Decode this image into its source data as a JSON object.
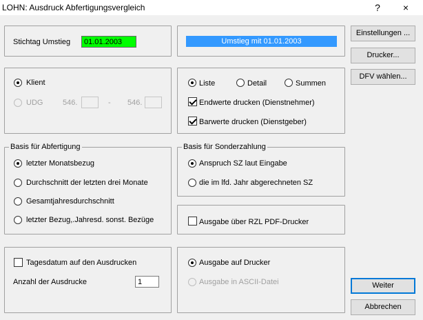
{
  "window": {
    "title": "LOHN: Ausdruck Abfertigungsvergleich",
    "help_glyph": "?",
    "close_glyph": "×"
  },
  "stichtag": {
    "label": "Stichtag Umstieg",
    "value": "01.01.2003",
    "value_bg": "#00ff00"
  },
  "umstieg_banner": {
    "text": "Umstieg mit 01.01.2003",
    "bg": "#3399ff"
  },
  "scope": {
    "klient_label": "Klient",
    "udg_label": "UDG",
    "range_prefix_1": "546.",
    "range_sep": "-",
    "range_prefix_2": "546.",
    "range_from": "",
    "range_to": ""
  },
  "mode": {
    "liste": "Liste",
    "detail": "Detail",
    "summen": "Summen",
    "endwerte": "Endwerte drucken (Dienstnehmer)",
    "barwerte": "Barwerte drucken (Dienstgeber)"
  },
  "basis_abfertigung": {
    "legend": "Basis für Abfertigung",
    "options": [
      "letzter Monatsbezug",
      "Durchschnitt der letzten drei Monate",
      "Gesamtjahresdurchschnitt",
      "letzter Bezug,.Jahresd. sonst. Bezüge"
    ]
  },
  "basis_sonderzahlung": {
    "legend": "Basis für Sonderzahlung",
    "options": [
      "Anspruch SZ laut Eingabe",
      "die im lfd. Jahr abgerechneten SZ"
    ]
  },
  "rzl": {
    "label": "Ausgabe über RZL PDF-Drucker"
  },
  "tagesdatum": {
    "label": "Tagesdatum auf den Ausdrucken"
  },
  "anzahl": {
    "label": "Anzahl der Ausdrucke",
    "value": "1"
  },
  "ausgabe": {
    "drucker": "Ausgabe auf Drucker",
    "ascii": "Ausgabe in ASCII-Datei"
  },
  "buttons": {
    "einstellungen": "Einstellungen ...",
    "drucker": "Drucker...",
    "dfv": "DFV wählen...",
    "weiter": "Weiter",
    "abbrechen": "Abbrechen"
  }
}
